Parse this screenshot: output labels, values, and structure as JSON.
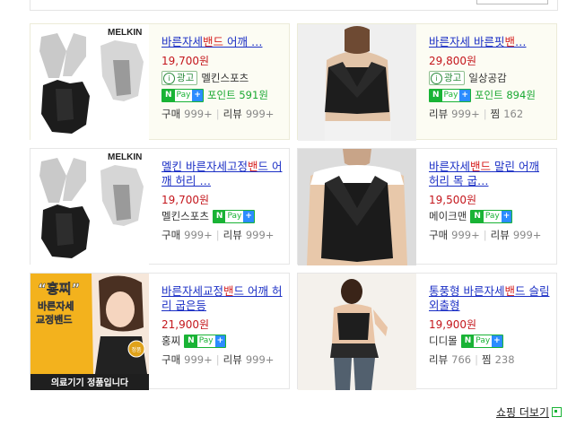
{
  "cards": [
    {
      "title_pre": "바른자세",
      "title_hl": "밴드",
      "title_post": " 어깨 …",
      "price": "19,700원",
      "ad": true,
      "ad_label": "광고",
      "seller": "멜킨스포츠",
      "npay": true,
      "point": "포인트 591원",
      "stats": [
        {
          "k": "구매",
          "v": "999+"
        },
        {
          "k": "리뷰",
          "v": "999+"
        }
      ]
    },
    {
      "title_pre": "바른자세 바른핏",
      "title_hl": "밴",
      "title_post": "…",
      "price": "29,800원",
      "ad": true,
      "ad_label": "광고",
      "seller": "일상공감",
      "npay": true,
      "point": "포인트 894원",
      "stats": [
        {
          "k": "리뷰",
          "v": "999+"
        },
        {
          "k": "찜",
          "v": "162"
        }
      ]
    },
    {
      "title_pre": "멜킨 바른자세고정",
      "title_hl": "밴",
      "title_post": "드 어깨 허리 …",
      "price": "19,700원",
      "ad": false,
      "seller": "멜킨스포츠",
      "npay": true,
      "point": "",
      "stats": [
        {
          "k": "구매",
          "v": "999+"
        },
        {
          "k": "리뷰",
          "v": "999+"
        }
      ]
    },
    {
      "title_pre": "바른자세",
      "title_hl": "밴드",
      "title_post": " 말린 어깨 허리 목 굽…",
      "price": "19,500원",
      "ad": false,
      "seller": "메이크맨",
      "npay": true,
      "point": "",
      "stats": [
        {
          "k": "구매",
          "v": "999+"
        },
        {
          "k": "리뷰",
          "v": "999+"
        }
      ]
    },
    {
      "title_pre": "바른자세교정",
      "title_hl": "밴",
      "title_post": "드 어깨 허리 굽은등",
      "price": "21,900원",
      "ad": false,
      "seller": "홍찌",
      "npay": true,
      "point": "",
      "stats": [
        {
          "k": "구매",
          "v": "999+"
        },
        {
          "k": "리뷰",
          "v": "999+"
        }
      ]
    },
    {
      "title_pre": "통풍형 바른자세",
      "title_hl": "밴",
      "title_post": "드 슬림 외출형",
      "price": "19,900원",
      "ad": false,
      "seller": "디디몰",
      "npay": true,
      "point": "",
      "stats": [
        {
          "k": "리뷰",
          "v": "766"
        },
        {
          "k": "찜",
          "v": "238"
        }
      ]
    }
  ],
  "npay_badge": {
    "n": "N",
    "pay": "Pay",
    "plus": "+"
  },
  "thumb_text": {
    "melkin": "MELKIN",
    "hongjji_quote": "“홍찌”",
    "hongjji_line1": "바른자세",
    "hongjji_line2": "교정밴드",
    "hongjji_footer": "의료기기 정품입니다",
    "hongjji_seal": "정품"
  },
  "more_link": "쇼핑 더보기",
  "colors": {
    "title": "#1b2fc5",
    "highlight": "#d61f1f",
    "price": "#c4161c",
    "npay_green": "#19b335"
  }
}
